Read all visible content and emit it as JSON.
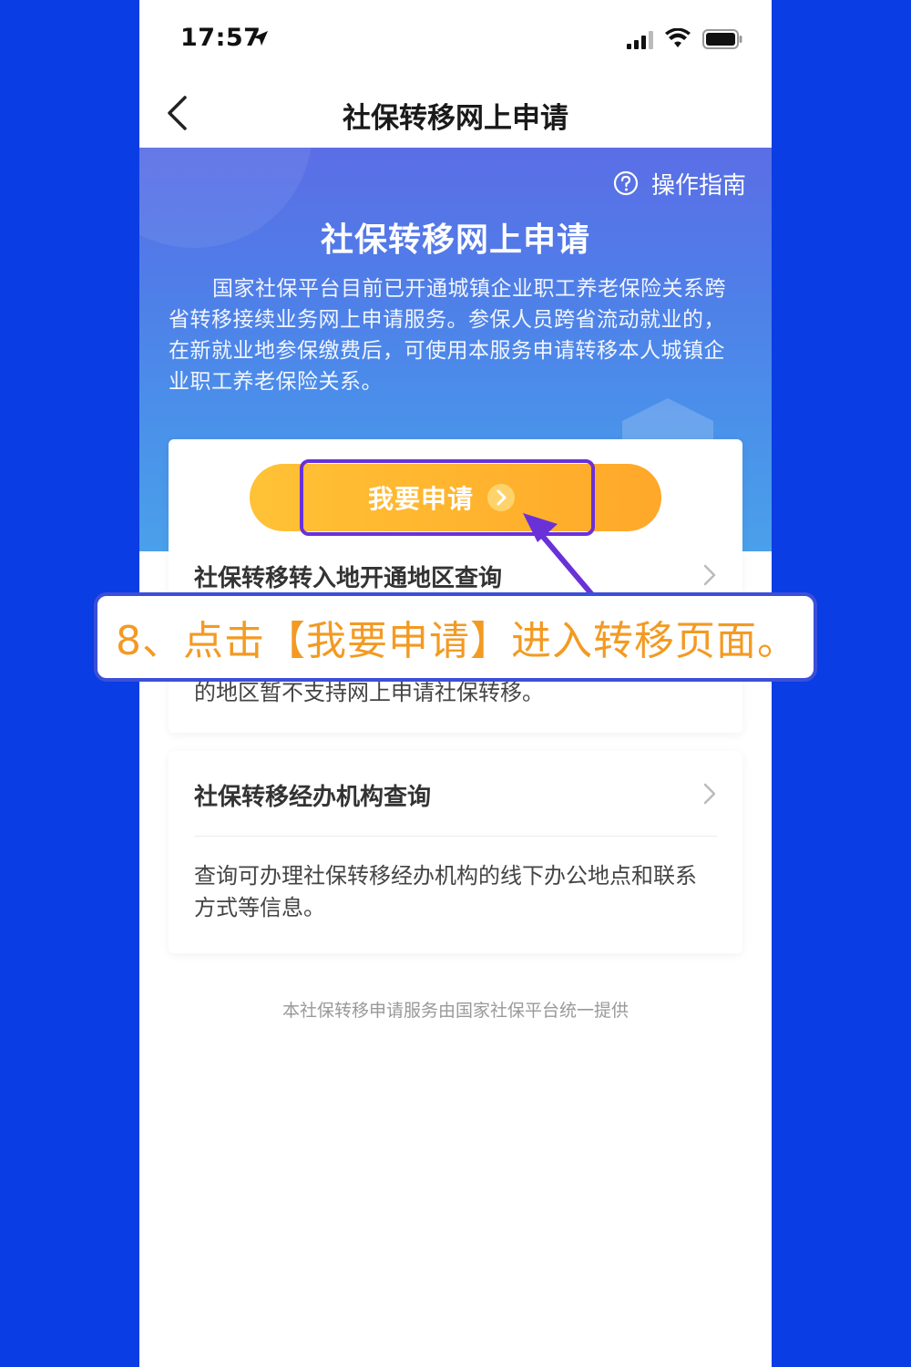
{
  "status_bar": {
    "time": "17:57"
  },
  "nav": {
    "title": "社保转移网上申请",
    "back_icon": "chevron-left-icon"
  },
  "banner": {
    "guide_label": "操作指南",
    "guide_icon": "question-circle-icon",
    "title": "社保转移网上申请",
    "description": "国家社保平台目前已开通城镇企业职工养老保险关系跨省转移接续业务网上申请服务。参保人员跨省流动就业的，在新就业地参保缴费后，可使用本服务申请转移本人城镇企业职工养老保险关系。"
  },
  "card1": {
    "apply_label": "我要申请",
    "row_title": "社保转移转入地开通地区查询",
    "desc_partial": "的地区暂不支持网上申请社保转移。"
  },
  "card2": {
    "row_title": "社保转移经办机构查询",
    "description": "查询可办理社保转移经办机构的线下办公地点和联系方式等信息。"
  },
  "footer": {
    "note": "本社保转移申请服务由国家社保平台统一提供"
  },
  "overlay": {
    "caption": "8、点击【我要申请】进入转移页面。"
  },
  "colors": {
    "page_background": "#0a3de3",
    "apply_button": "#ffb22d",
    "highlight": "#6a31d8",
    "caption_text": "#f39a23"
  }
}
